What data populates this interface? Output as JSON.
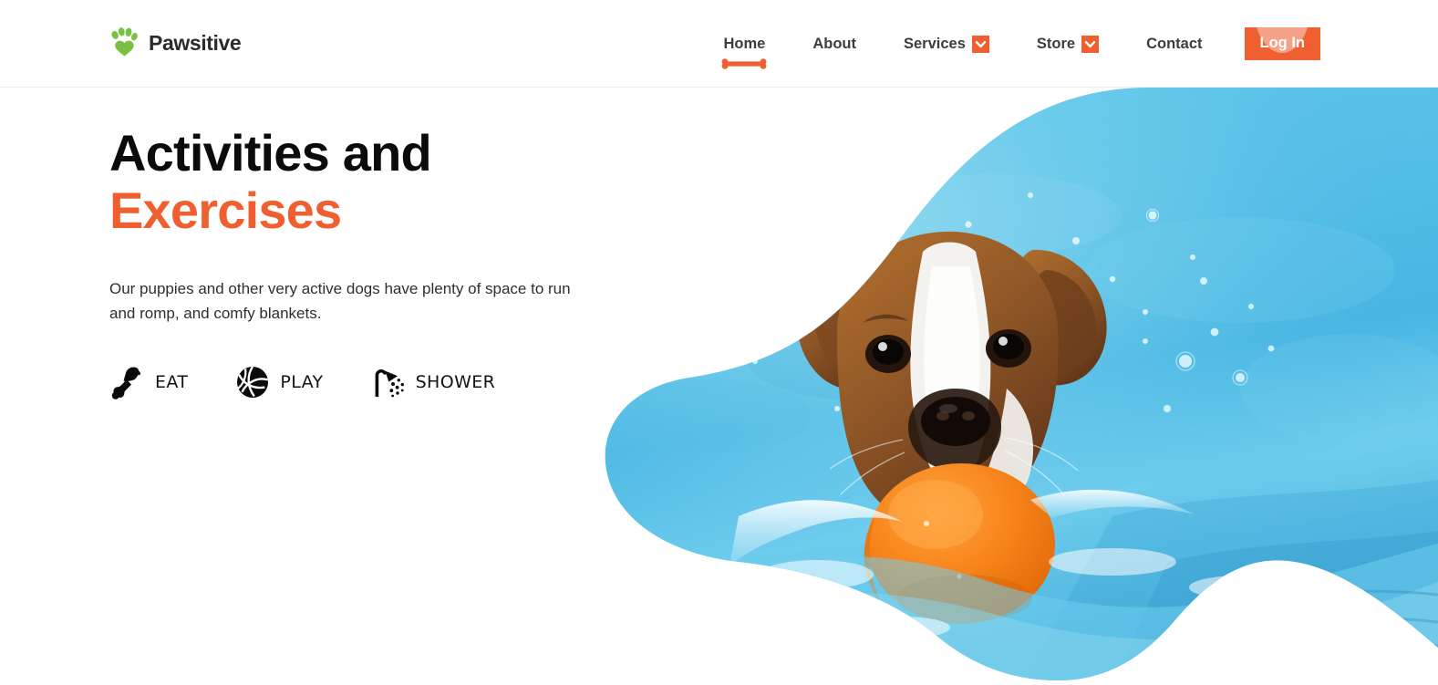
{
  "brand": {
    "name": "Pawsitive",
    "logo_icon": "paw-icon",
    "logo_color": "#7ac143",
    "text_color": "#2b2b2b"
  },
  "theme": {
    "accent": "#ef5f30",
    "accent_light": "#f4a188",
    "green": "#7ac143",
    "text_dark": "#0b0b0b",
    "text_body": "#2f2f2f",
    "header_border": "#ececec",
    "water_blue": "#5ec5e8",
    "ball_orange": "#f57f20"
  },
  "nav": {
    "items": [
      {
        "label": "Home",
        "active": true,
        "has_dropdown": false,
        "icon": ""
      },
      {
        "label": "About",
        "active": false,
        "has_dropdown": false,
        "icon": ""
      },
      {
        "label": "Services",
        "active": false,
        "has_dropdown": true,
        "icon": "chevron-down-icon"
      },
      {
        "label": "Store",
        "active": false,
        "has_dropdown": true,
        "icon": "chevron-down-icon"
      },
      {
        "label": "Contact",
        "active": false,
        "has_dropdown": false,
        "icon": ""
      }
    ],
    "active_underline_icon": "bone-icon",
    "login": {
      "label": "Log In"
    }
  },
  "hero": {
    "title_line1": "Activities and",
    "title_line2": "Exercises",
    "paragraph": "Our puppies and other very active dogs have plenty of space to run and romp, and comfy blankets.",
    "features": [
      {
        "label": "EAT",
        "icon": "drumstick-icon"
      },
      {
        "label": "PLAY",
        "icon": "volleyball-icon"
      },
      {
        "label": "SHOWER",
        "icon": "showerhead-icon"
      }
    ],
    "image": {
      "alt": "Jack Russell terrier swimming in a blue pool carrying an orange ball in its mouth",
      "mask": "organic-blob"
    }
  }
}
